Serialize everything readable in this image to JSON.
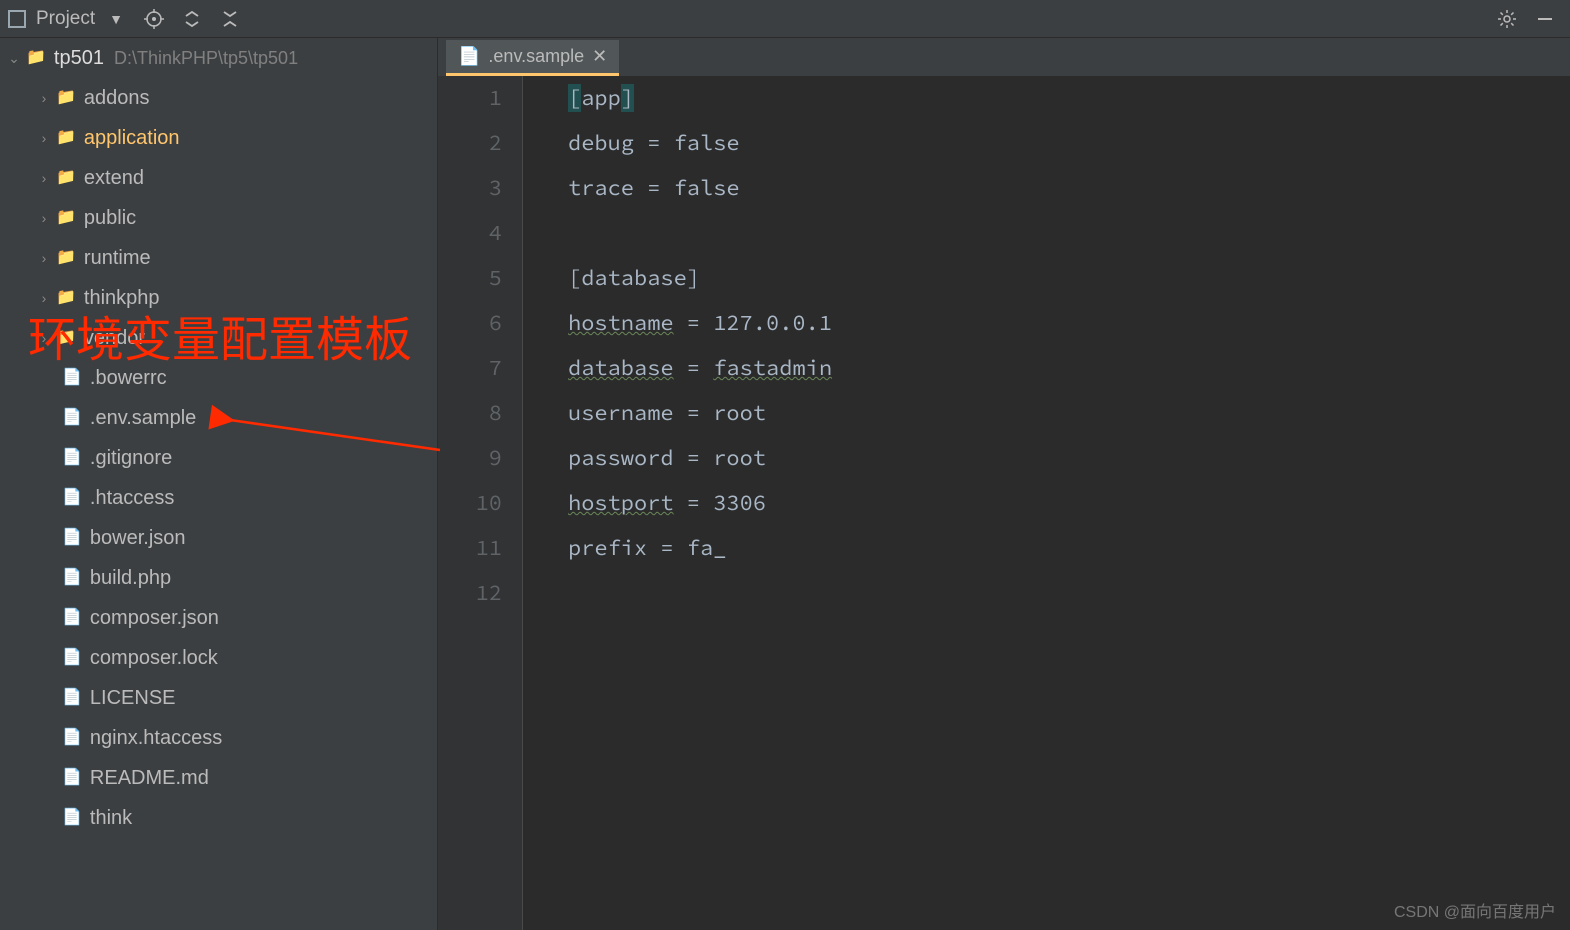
{
  "toolbar": {
    "project_label": "Project"
  },
  "tabs": {
    "active": ".env.sample"
  },
  "tree": {
    "root": {
      "name": "tp501",
      "path": "D:\\ThinkPHP\\tp5\\tp501"
    },
    "folders": [
      {
        "name": "addons"
      },
      {
        "name": "application",
        "active": true
      },
      {
        "name": "extend"
      },
      {
        "name": "public"
      },
      {
        "name": "runtime"
      },
      {
        "name": "thinkphp"
      },
      {
        "name": "vendor"
      }
    ],
    "files": [
      {
        "name": ".bowerrc",
        "icon": "file"
      },
      {
        "name": ".env.sample",
        "icon": "file"
      },
      {
        "name": ".gitignore",
        "icon": "gitignore"
      },
      {
        "name": ".htaccess",
        "icon": "htaccess"
      },
      {
        "name": "bower.json",
        "icon": "json"
      },
      {
        "name": "build.php",
        "icon": "php"
      },
      {
        "name": "composer.json",
        "icon": "json"
      },
      {
        "name": "composer.lock",
        "icon": "json"
      },
      {
        "name": "LICENSE",
        "icon": "file"
      },
      {
        "name": "nginx.htaccess",
        "icon": "file"
      },
      {
        "name": "README.md",
        "icon": "md"
      },
      {
        "name": "think",
        "icon": "php"
      }
    ]
  },
  "editor": {
    "lines": [
      "[app]",
      "debug = false",
      "trace = false",
      "",
      "[database]",
      "hostname = 127.0.0.1",
      "database = fastadmin",
      "username = root",
      "password = root",
      "hostport = 3306",
      "prefix = fa_",
      ""
    ]
  },
  "annotation": {
    "text": "环境变量配置模板"
  },
  "watermark": "CSDN @面向百度用户"
}
